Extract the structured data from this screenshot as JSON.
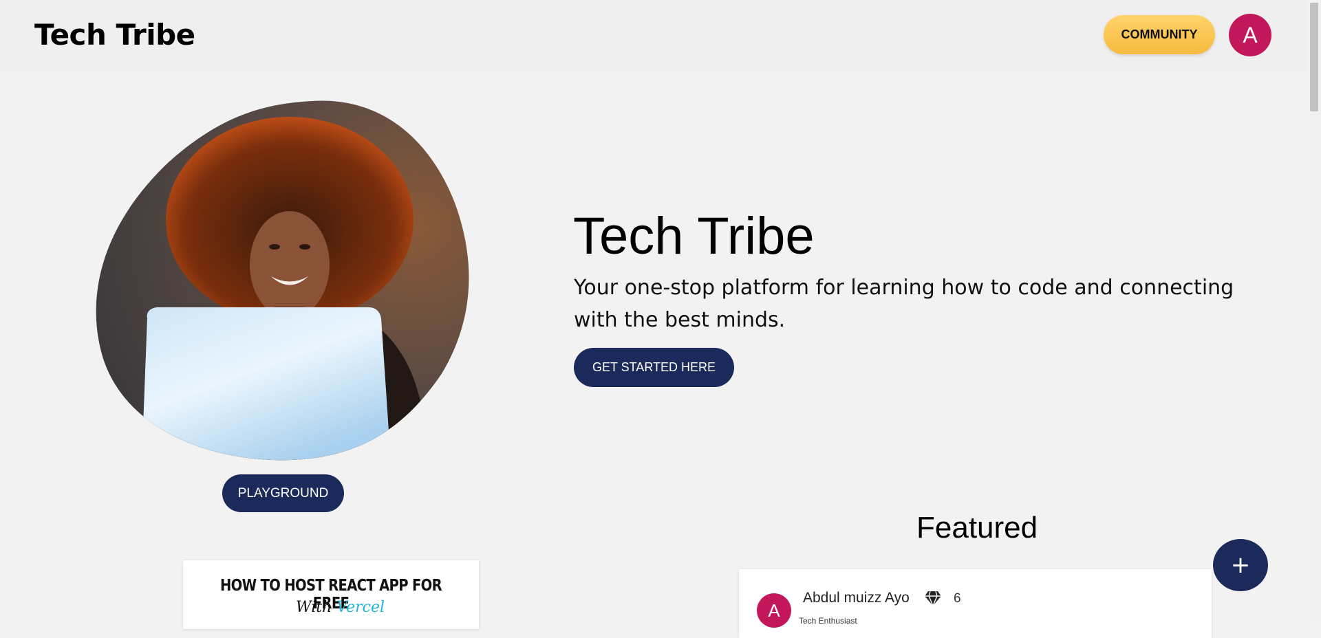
{
  "header": {
    "logo": "Tech Tribe",
    "community_label": "COMMUNITY",
    "avatar_initial": "A"
  },
  "hero": {
    "title": "Tech Tribe",
    "subtitle": "Your one-stop platform for learning how to code and connecting with the best minds.",
    "cta_label": "GET STARTED HERE",
    "playground_label": "PLAYGROUND"
  },
  "featured": {
    "heading": "Featured",
    "fab_label": "+"
  },
  "blog_card": {
    "title": "HOW TO HOST REACT APP FOR FREE",
    "with_text": "With",
    "brand_text": "Vercel"
  },
  "post": {
    "avatar_initial": "A",
    "author": "Abdul muizz Ayo",
    "badge_icon": "gem-icon",
    "count": "6",
    "role": "Tech Enthusiast"
  },
  "colors": {
    "navy": "#1b2a5a",
    "accent_yellow": "#f7bb3e",
    "avatar_pink": "#c2185b",
    "vercel_cyan": "#22b6d6"
  }
}
